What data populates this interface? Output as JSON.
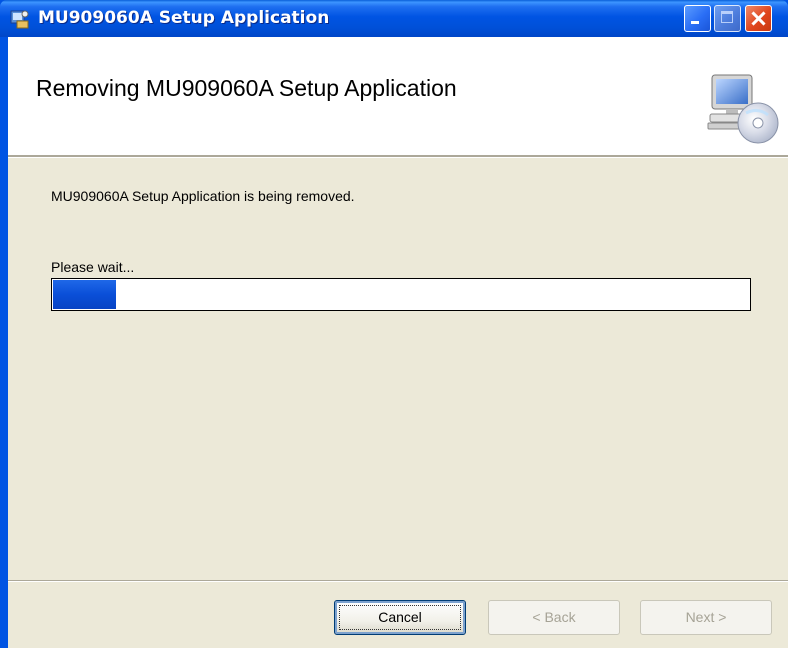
{
  "window": {
    "title": "MU909060A Setup Application",
    "title_bar_color": "#0054e3",
    "controls": {
      "minimize": "minimize-icon",
      "maximize": "maximize-icon",
      "close": "close-icon"
    }
  },
  "header": {
    "title": "Removing MU909060A Setup Application",
    "icon": "computer-cd-icon"
  },
  "body": {
    "status_text": "MU909060A Setup Application is being removed.",
    "wait_label": "Please wait...",
    "progress_fraction": 0.09,
    "progress_color": "#0a4fd8"
  },
  "buttons": {
    "cancel": "Cancel",
    "back": "< Back",
    "next": "Next >"
  },
  "colors": {
    "dialog_bg": "#ece9d8",
    "header_bg": "#ffffff"
  }
}
